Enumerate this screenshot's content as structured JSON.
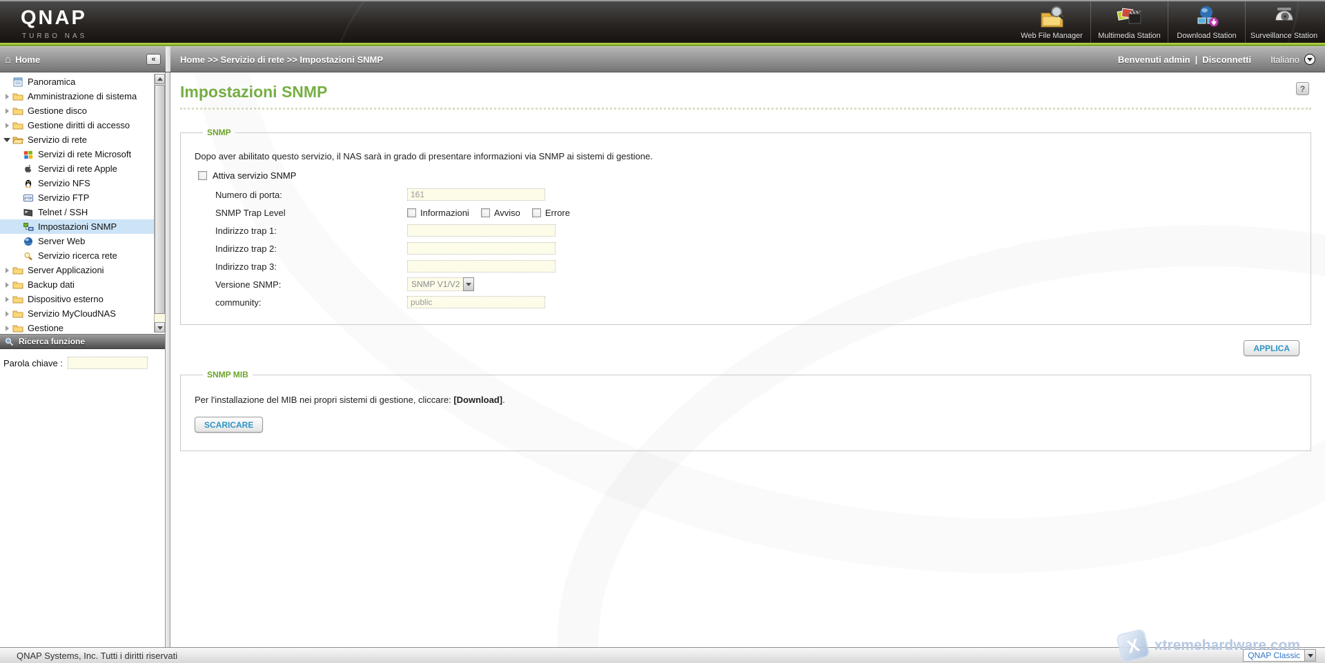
{
  "header": {
    "logo": {
      "title": "QNAP",
      "subtitle": "TURBO NAS"
    },
    "stations": [
      {
        "label": "Web File Manager",
        "icon": "web-file-manager-icon"
      },
      {
        "label": "Multimedia Station",
        "icon": "multimedia-station-icon"
      },
      {
        "label": "Download Station",
        "icon": "download-station-icon"
      },
      {
        "label": "Surveillance Station",
        "icon": "surveillance-station-icon"
      }
    ]
  },
  "breadcrumb": {
    "path": "Home >> Servizio di rete >> Impostazioni SNMP",
    "welcome": "Benvenuti admin",
    "separator": "|",
    "logout": "Disconnetti",
    "language": "Italiano"
  },
  "sidebar": {
    "panel_title": "Home",
    "collapse_glyph": "«",
    "tree": [
      {
        "label": "Panoramica",
        "icon": "overview",
        "level": 0,
        "state": "leaf",
        "selected": false
      },
      {
        "label": "Amministrazione di sistema",
        "icon": "folder",
        "level": 0,
        "state": "collapsed",
        "selected": false
      },
      {
        "label": "Gestione disco",
        "icon": "folder",
        "level": 0,
        "state": "collapsed",
        "selected": false
      },
      {
        "label": "Gestione diritti di accesso",
        "icon": "folder",
        "level": 0,
        "state": "collapsed",
        "selected": false
      },
      {
        "label": "Servizio di rete",
        "icon": "folder-open",
        "level": 0,
        "state": "expanded",
        "selected": false
      },
      {
        "label": "Servizi di rete Microsoft",
        "icon": "windows",
        "level": 1,
        "state": "leaf",
        "selected": false
      },
      {
        "label": "Servizi di rete Apple",
        "icon": "apple",
        "level": 1,
        "state": "leaf",
        "selected": false
      },
      {
        "label": "Servizio NFS",
        "icon": "linux",
        "level": 1,
        "state": "leaf",
        "selected": false
      },
      {
        "label": "Servizio FTP",
        "icon": "ftp",
        "level": 1,
        "state": "leaf",
        "selected": false
      },
      {
        "label": "Telnet / SSH",
        "icon": "terminal",
        "level": 1,
        "state": "leaf",
        "selected": false
      },
      {
        "label": "Impostazioni SNMP",
        "icon": "snmp",
        "level": 1,
        "state": "leaf",
        "selected": true
      },
      {
        "label": "Server Web",
        "icon": "globe",
        "level": 1,
        "state": "leaf",
        "selected": false
      },
      {
        "label": "Servizio ricerca rete",
        "icon": "network-search",
        "level": 1,
        "state": "leaf",
        "selected": false
      },
      {
        "label": "Server Applicazioni",
        "icon": "folder",
        "level": 0,
        "state": "collapsed",
        "selected": false
      },
      {
        "label": "Backup dati",
        "icon": "folder",
        "level": 0,
        "state": "collapsed",
        "selected": false
      },
      {
        "label": "Dispositivo esterno",
        "icon": "folder",
        "level": 0,
        "state": "collapsed",
        "selected": false
      },
      {
        "label": "Servizio MyCloudNAS",
        "icon": "folder",
        "level": 0,
        "state": "collapsed",
        "selected": false
      },
      {
        "label": "Gestione",
        "icon": "folder",
        "level": 0,
        "state": "collapsed",
        "selected": false
      }
    ],
    "search": {
      "panel_title": "Ricerca funzione",
      "label": "Parola chiave :",
      "value": ""
    }
  },
  "main": {
    "title": "Impostazioni SNMP",
    "help_glyph": "?",
    "snmp": {
      "legend": "SNMP",
      "description": "Dopo aver abilitato questo servizio, il NAS sarà in grado di presentare informazioni via SNMP ai sistemi di gestione.",
      "enable_label": "Attiva servizio SNMP",
      "enable_checked": false,
      "fields": {
        "port": {
          "label": "Numero di porta:",
          "value": "161"
        },
        "trap_level": {
          "label": "SNMP Trap Level",
          "options": [
            "Informazioni",
            "Avviso",
            "Errore"
          ],
          "checked": [
            false,
            false,
            false
          ]
        },
        "trap1": {
          "label": "Indirizzo trap 1:",
          "value": ""
        },
        "trap2": {
          "label": "Indirizzo trap 2:",
          "value": ""
        },
        "trap3": {
          "label": "Indirizzo trap 3:",
          "value": ""
        },
        "version": {
          "label": "Versione SNMP:",
          "value": "SNMP V1/V2"
        },
        "community": {
          "label": "community:",
          "value": "public"
        }
      },
      "apply_label": "APPLICA"
    },
    "mib": {
      "legend": "SNMP MIB",
      "text_before": "Per l'installazione del MIB nei propri sistemi di gestione, cliccare: ",
      "text_bold": "[Download]",
      "text_after": ".",
      "download_label": "SCARICARE"
    }
  },
  "footer": {
    "copyright": "QNAP Systems, Inc. Tutti i diritti riservati",
    "theme": "QNAP Classic"
  },
  "watermark": {
    "logo_glyph": "X",
    "text": "xtremehardware.com"
  },
  "colors": {
    "accent_green": "#76b043",
    "legend_green": "#6da32a",
    "stripe_green": "#a3c93f",
    "selected_item_bg": "#cde4f7",
    "button_text_blue": "#2e95c6",
    "input_bg": "#fdfce9",
    "watermark_blue": "#b5c8e2"
  }
}
